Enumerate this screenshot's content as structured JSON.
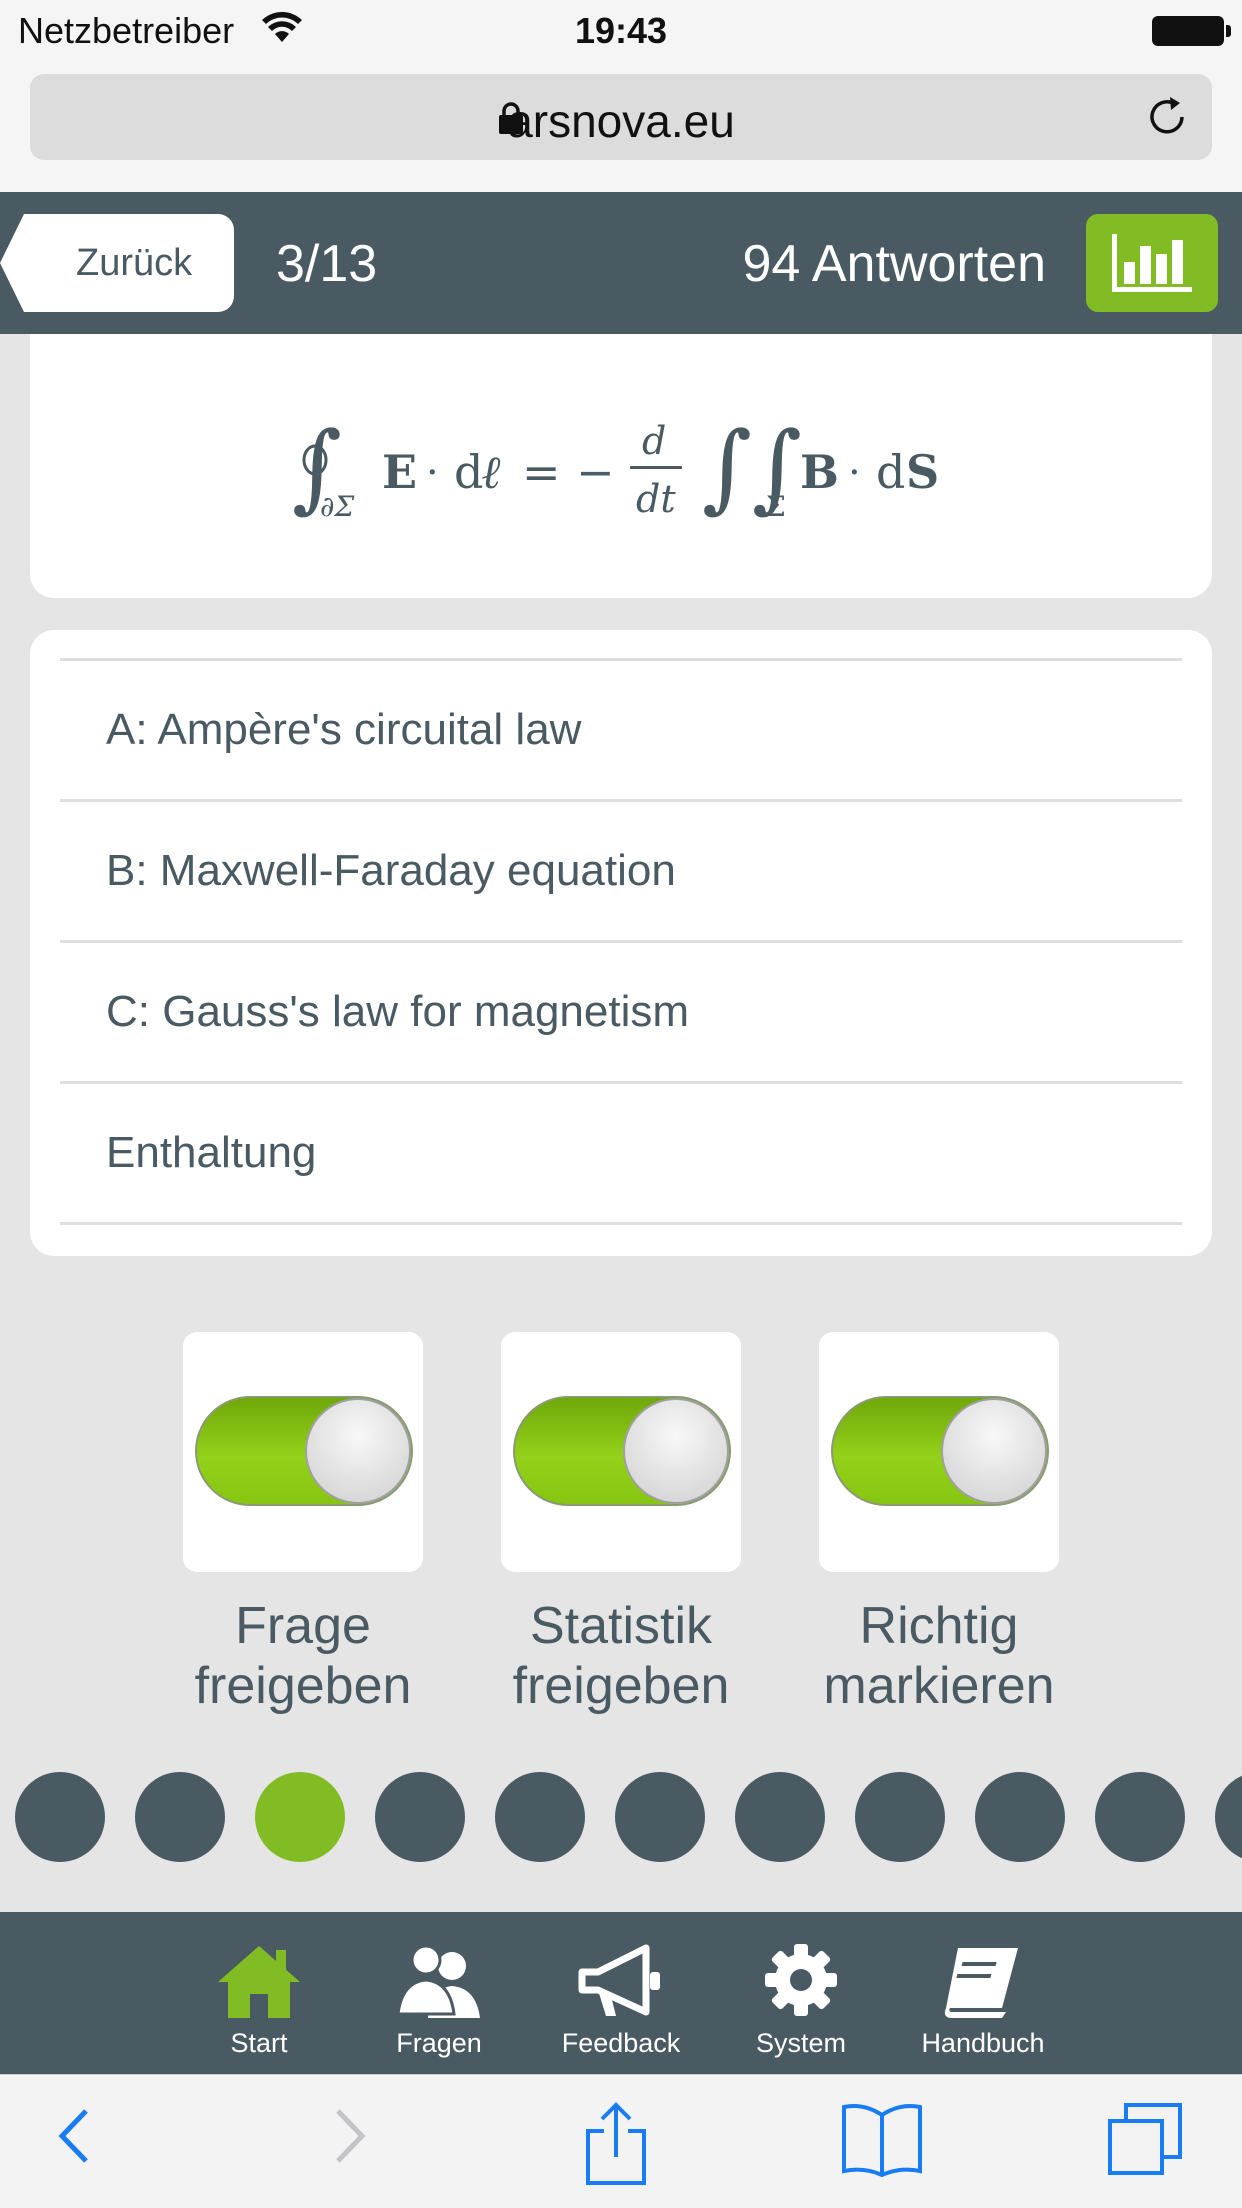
{
  "status_bar": {
    "carrier": "Netzbetreiber",
    "time": "19:43"
  },
  "browser": {
    "url": "arsnova.eu"
  },
  "header": {
    "back_label": "Zurück",
    "question_counter": "3/13",
    "answer_count": "94 Antworten"
  },
  "question": {
    "formula_icon": "formula-image",
    "options": [
      {
        "label": "A: Ampère's circuital law"
      },
      {
        "label": "B: Maxwell-Faraday equation"
      },
      {
        "label": "C: Gauss's law for magnetism"
      },
      {
        "label": "Enthaltung"
      }
    ]
  },
  "toggles": [
    {
      "label_line1": "Frage",
      "label_line2": "freigeben",
      "on": true
    },
    {
      "label_line1": "Statistik",
      "label_line2": "freigeben",
      "on": true
    },
    {
      "label_line1": "Richtig",
      "label_line2": "markieren",
      "on": true
    }
  ],
  "question_dots": {
    "active_index": 2,
    "visible_count": 11
  },
  "app_nav": [
    {
      "label": "Start",
      "icon": "home-icon",
      "active": true
    },
    {
      "label": "Fragen",
      "icon": "users-icon",
      "active": false
    },
    {
      "label": "Feedback",
      "icon": "megaphone-icon",
      "active": false
    },
    {
      "label": "System",
      "icon": "gear-icon",
      "active": false
    },
    {
      "label": "Handbuch",
      "icon": "book-icon",
      "active": false
    }
  ],
  "colors": {
    "header": "#4a5a63",
    "accent": "#82bc24",
    "background": "#e5e5e5"
  }
}
